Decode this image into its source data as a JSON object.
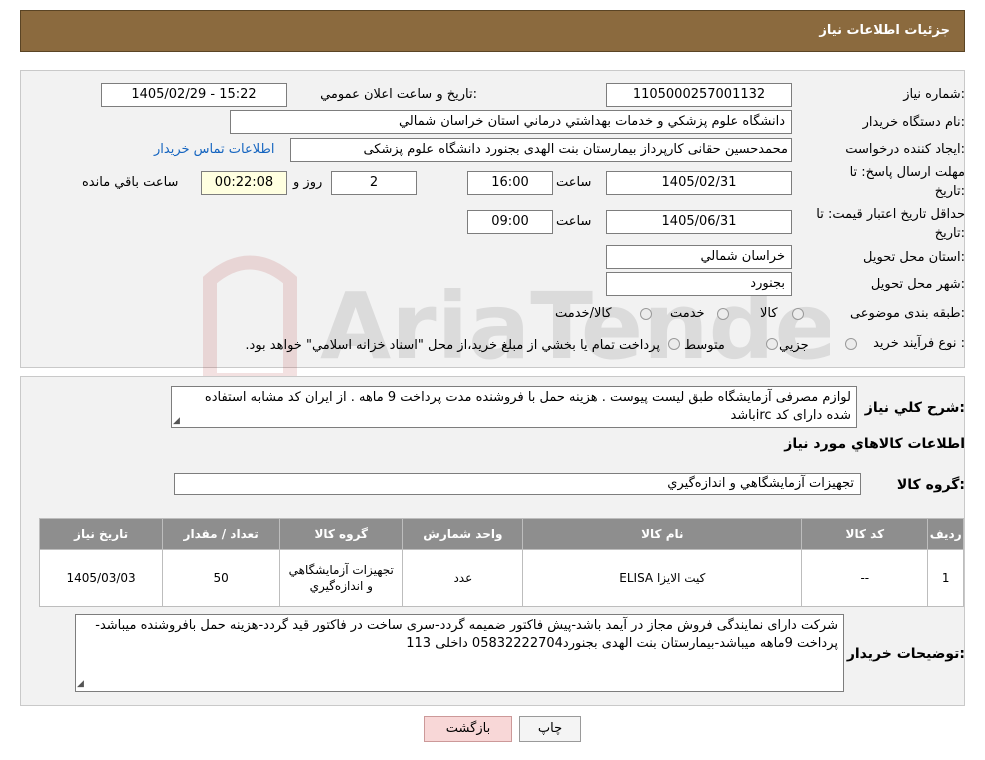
{
  "header": {
    "title": "جزئیات اطلاعات نیاز"
  },
  "fields": {
    "need_number_label": "شماره نیاز:",
    "need_number": "1105000257001132",
    "announce_label": "تاریخ و ساعت اعلان عمومي:",
    "announce_value": "1405/02/29 - 15:22",
    "buyer_org_label": "نام دستگاه خريدار:",
    "buyer_org": "دانشگاه علوم پزشكي و خدمات بهداشتي درماني استان خراسان شمالي",
    "creator_label": "ايجاد كننده درخواست:",
    "creator": "محمدحسین حقانی کارپرداز بیمارستان بنت الهدی بجنورد دانشگاه علوم پزشکی",
    "contact_link": "اطلاعات تماس خريدار",
    "deadline_label_1": "مهلت ارسال پاسخ: تا",
    "deadline_label_2": "تاريخ:",
    "deadline_date": "1405/02/31",
    "time_label": "ساعت",
    "deadline_time": "16:00",
    "days_value": "2",
    "days_label": "روز و",
    "remaining_value": "00:22:08",
    "remaining_label": "ساعت باقي مانده",
    "validity_label_1": "حداقل تاريخ اعتبار قيمت: تا",
    "validity_label_2": "تاريخ:",
    "validity_date": "1405/06/31",
    "validity_time": "09:00",
    "province_label": "استان محل تحويل:",
    "province": "خراسان شمالي",
    "city_label": "شهر محل تحويل:",
    "city": "بجنورد",
    "category_label": "طبقه بندی موضوعی:",
    "category_options": [
      "كالا",
      "خدمت",
      "كالا/خدمت"
    ],
    "purchase_type_label": "نوع فرآيند خريد :",
    "purchase_options": [
      "جزيي",
      "متوسط"
    ],
    "purchase_note": "پرداخت تمام يا بخشي از مبلغ خريد،از محل \"اسناد خزانه اسلامي\" خواهد بود."
  },
  "description": {
    "label": "شرح كلي نياز:",
    "text": "لوازم مصرفی آزمایشگاه طبق لیست پیوست . هزینه حمل با فروشنده مدت پرداخت 9 ماهه . از ایران کد مشابه استفاده شده دارای کد ircباشد"
  },
  "goods_section_title": "اطلاعات كالاهاي مورد نياز",
  "goods_group_label": "گروه كالا:",
  "goods_group": "تجهيزات آزمايشگاهي و اندازه‌گيري",
  "table": {
    "headers": [
      "رديف",
      "كد كالا",
      "نام كالا",
      "واحد شمارش",
      "گروه كالا",
      "تعداد / مقدار",
      "تاريخ نياز"
    ],
    "rows": [
      [
        "1",
        "--",
        "کیت الایزا ELISA",
        "عدد",
        "تجهيزات آزمايشگاهي و اندازه‌گيري",
        "50",
        "1405/03/03"
      ]
    ]
  },
  "buyer_notes": {
    "label": "توضيحات خريدار:",
    "text": "شرکت دارای نمایندگی فروش مجاز در آیمد باشد-پیش فاکتور ضمیمه گردد-سری ساخت در فاکتور قید گردد-هزینه حمل بافروشنده میباشد-پرداخت 9ماهه میباشد-بیمارستان بنت الهدی بجنورد05832222704 داخلی 113"
  },
  "buttons": {
    "print": "چاپ",
    "back": "بازگشت"
  },
  "watermark_text": "AriaTender.neT"
}
